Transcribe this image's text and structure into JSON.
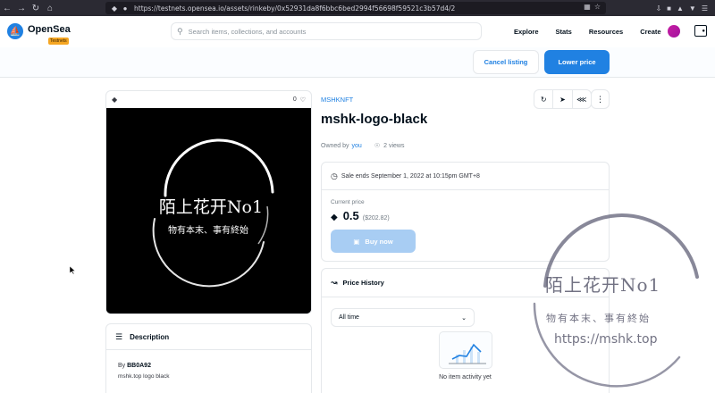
{
  "browser": {
    "url": "https://testnets.opensea.io/assets/rinkeby/0x52931da8f6bbc6bed2994f56698f59521c3b57d4/2"
  },
  "header": {
    "brand": "OpenSea",
    "badge": "Testnets",
    "search_placeholder": "Search items, collections, and accounts",
    "nav": [
      "Explore",
      "Stats",
      "Resources",
      "Create"
    ]
  },
  "actions": {
    "cancel_label": "Cancel listing",
    "lower_label": "Lower price"
  },
  "asset": {
    "favorites": "0",
    "collection": "MSHKNFT",
    "title": "mshk-logo-black",
    "owned_by_label": "Owned by",
    "owner": "you",
    "views": "2 views",
    "image_text_main": "陌上花开No1",
    "image_text_sub": "物有本末、事有終始"
  },
  "description": {
    "heading": "Description",
    "by_label": "By",
    "creator": "BB0A92",
    "text": "mshk.top logo black"
  },
  "sale": {
    "ends": "Sale ends September 1, 2022 at 10:15pm GMT+8",
    "current_label": "Current price",
    "price": "0.5",
    "usd": "($202.82)",
    "buy_label": "Buy now"
  },
  "history": {
    "heading": "Price History",
    "range": "All time",
    "empty": "No item activity yet"
  },
  "watermark": {
    "line1": "陌上花开No1",
    "line2": "物有本末、事有終始",
    "line3": "https://mshk.top"
  },
  "colors": {
    "accent": "#2081e2",
    "buy_disabled": "#a8cdf3",
    "browser_chrome": "#2b2a33"
  }
}
